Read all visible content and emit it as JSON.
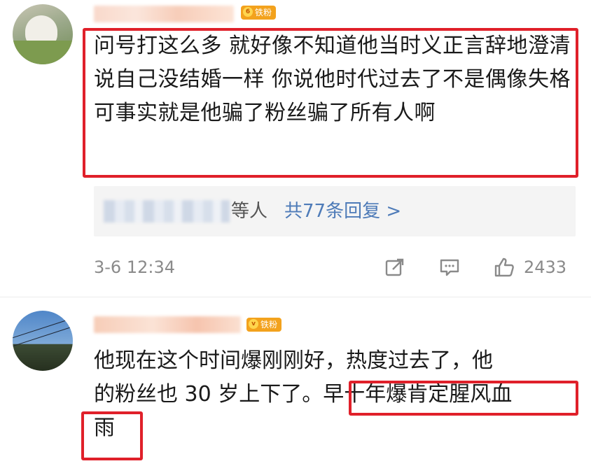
{
  "comments": [
    {
      "badge": "铁粉",
      "badge_level": "6",
      "text": "问号打这么多 就好像不知道他当时义正言辞地澄清说自己没结婚一样 你说他时代过去了不是偶像失格 可事实就是他骗了粉丝骗了所有人啊",
      "replies_suffix": "等人",
      "replies_count": "共77条回复 >",
      "time": "3-6 12:34",
      "likes": "2433"
    },
    {
      "badge": "铁粉",
      "badge_level": "v",
      "line1": "他现在这个时间爆刚刚好，热度过去了，他",
      "line2_a": "的粉丝也 30 岁上下了。",
      "line2_b": "早十年爆肯定腥风血",
      "line3": "雨"
    }
  ],
  "colors": {
    "highlight_box": "#e0202a",
    "badge": "#f3a21d",
    "reply_link": "#4e7bb8"
  },
  "icons": [
    "share-icon",
    "comment-icon",
    "like-icon",
    "crown-icon"
  ]
}
